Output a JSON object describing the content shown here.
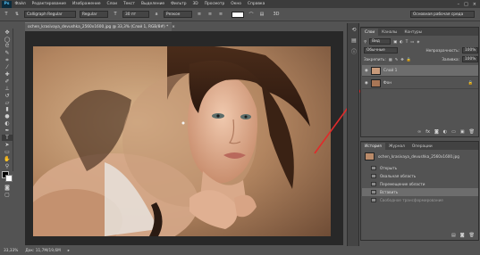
{
  "app": {
    "logo": "Ps",
    "menu": [
      "Файл",
      "Редактирование",
      "Изображение",
      "Слои",
      "Текст",
      "Выделение",
      "Фильтр",
      "3D",
      "Просмотр",
      "Окно",
      "Справка"
    ],
    "window_buttons": [
      "–",
      "□",
      "×"
    ]
  },
  "options_bar": {
    "font_family": "Calligraph Regular",
    "font_style": "Regular",
    "font_size": "30 пт",
    "aa": "Резкое",
    "workspace": "Основная рабочая среда"
  },
  "document": {
    "tab_title": "ochen_krasivaya_devushka_2560x1600.jpg @ 33,3% (Слой 1, RGB/8#) *",
    "close": "×"
  },
  "status": {
    "zoom": "33,33%",
    "doc_size": "Док: 11,7M/19,6M"
  },
  "layers_panel": {
    "tabs": [
      "Слои",
      "Каналы",
      "Контуры"
    ],
    "filter_label": "Вид",
    "blend_mode": "Обычные",
    "opacity_label": "Непрозрачность:",
    "opacity_value": "100%",
    "lock_label": "Закрепить:",
    "fill_label": "Заливка:",
    "fill_value": "100%",
    "layers": [
      {
        "name": "Слой 1"
      },
      {
        "name": "Фон"
      }
    ],
    "bottom_icons": [
      "link-icon",
      "fx-icon",
      "mask-icon",
      "adjustment-icon",
      "folder-icon",
      "new-layer-icon",
      "trash-icon"
    ]
  },
  "history_panel": {
    "tabs": [
      "История",
      "Журнал",
      "Операции"
    ],
    "snapshot": "ochen_krasivaya_devushka_2560x1600.jpg",
    "items": [
      "Открыть",
      "Овальная область",
      "Перемещение области",
      "Вставить",
      "Свободное трансформирование"
    ],
    "selected_index": 3
  },
  "colors": {
    "accent_red": "#e02a2a",
    "selected_row": "#6d6d6d"
  }
}
